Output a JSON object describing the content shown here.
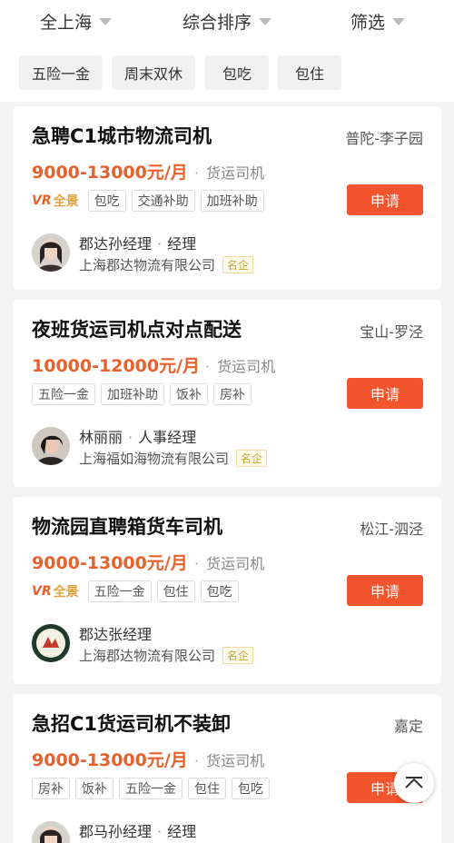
{
  "filters": {
    "area": "全上海",
    "sort": "综合排序",
    "screen": "筛选"
  },
  "quick_tags": [
    "五险一金",
    "周末双休",
    "包吃",
    "包住"
  ],
  "jobs": [
    {
      "title": "急聘C1城市物流司机",
      "location": "普陀-李子园",
      "salary": "9000-13000元/月",
      "category": "货运司机",
      "vr_label": "全景",
      "vr_prefix": "VR",
      "tags": [
        "包吃",
        "交通补助",
        "加班补助"
      ],
      "apply_label": "申请",
      "recruiter": "郡达孙经理",
      "role": "经理",
      "company": "上海郡达物流有限公司",
      "badge": "名企"
    },
    {
      "title": "夜班货运司机点对点配送",
      "location": "宝山-罗泾",
      "salary": "10000-12000元/月",
      "category": "货运司机",
      "tags": [
        "五险一金",
        "加班补助",
        "饭补",
        "房补"
      ],
      "apply_label": "申请",
      "recruiter": "林丽丽",
      "role": "人事经理",
      "company": "上海福如海物流有限公司",
      "badge": "名企"
    },
    {
      "title": "物流园直聘箱货车司机",
      "location": "松江-泗泾",
      "salary": "9000-13000元/月",
      "category": "货运司机",
      "vr_label": "全景",
      "vr_prefix": "VR",
      "tags": [
        "五险一金",
        "包住",
        "包吃"
      ],
      "apply_label": "申请",
      "recruiter": "郡达张经理",
      "company": "上海郡达物流有限公司",
      "badge": "名企"
    },
    {
      "title": "急招C1货运司机不装卸",
      "location": "嘉定",
      "salary": "9000-13000元/月",
      "category": "货运司机",
      "tags": [
        "房补",
        "饭补",
        "五险一金",
        "包住",
        "包吃"
      ],
      "apply_label": "申请",
      "recruiter": "郡马孙经理",
      "role": "经理"
    }
  ],
  "icons": {
    "dropdown": "chevron-down-icon",
    "back_to_top": "back-to-top-icon"
  },
  "colors": {
    "salary": "#e8612c",
    "apply_button": "#f2542d",
    "badge": "#c9a43a"
  }
}
